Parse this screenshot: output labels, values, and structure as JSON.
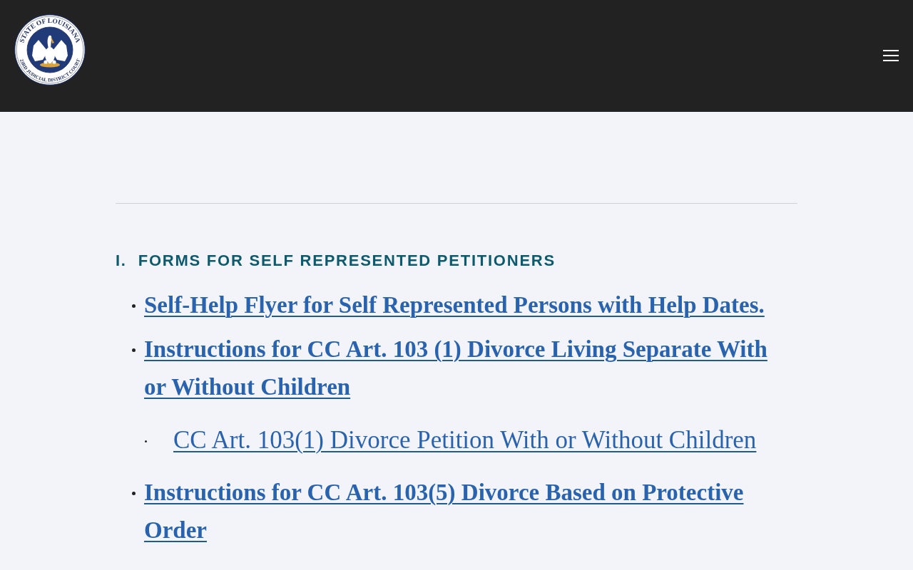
{
  "header": {
    "logo": {
      "ring_top": "STATE OF LOUISIANA",
      "ring_bottom": "23RD JUDICIAL DISTRICT COURT"
    }
  },
  "section": {
    "number": "I.",
    "title": "FORMS FOR SELF REPRESENTED PETITIONERS",
    "items": [
      {
        "label": "Self-Help Flyer for Self Represented Persons with Help Dates."
      },
      {
        "label": "Instructions for CC Art. 103 (1) Divorce Living Separate With or Without Children",
        "children": [
          {
            "label": "CC Art. 103(1) Divorce Petition With or Without Children"
          }
        ]
      },
      {
        "label": "Instructions for CC Art. 103(5) Divorce Based on Protective Order"
      }
    ]
  }
}
